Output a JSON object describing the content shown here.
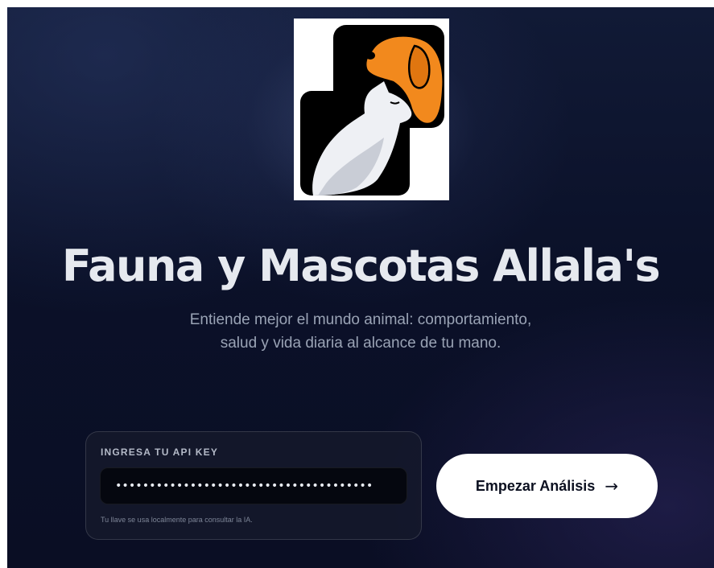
{
  "app": {
    "title": "Fauna y Mascotas Allala's",
    "subtitle_line1": "Entiende mejor el mundo animal: comportamiento,",
    "subtitle_line2": "salud y vida diaria al alcance de tu mano."
  },
  "logo": {
    "icon": "dog-and-cat-logo",
    "dog_color": "#f2891d",
    "cat_color": "#eef0f4",
    "panel_color": "#000000"
  },
  "api_card": {
    "label": "INGRESA TU API KEY",
    "value": "••••••••••••••••••••••••••••••••••••••",
    "hint": "Tu llave se usa localmente para consultar la IA."
  },
  "start_button": {
    "label": "Empezar Análisis",
    "icon": "arrow-right-icon",
    "arrow": "→"
  },
  "colors": {
    "background": "#0b1129",
    "text_primary": "#e6e9ef",
    "text_secondary": "#9aa3b5",
    "button_bg": "#ffffff",
    "accent_orange": "#f2891d"
  }
}
